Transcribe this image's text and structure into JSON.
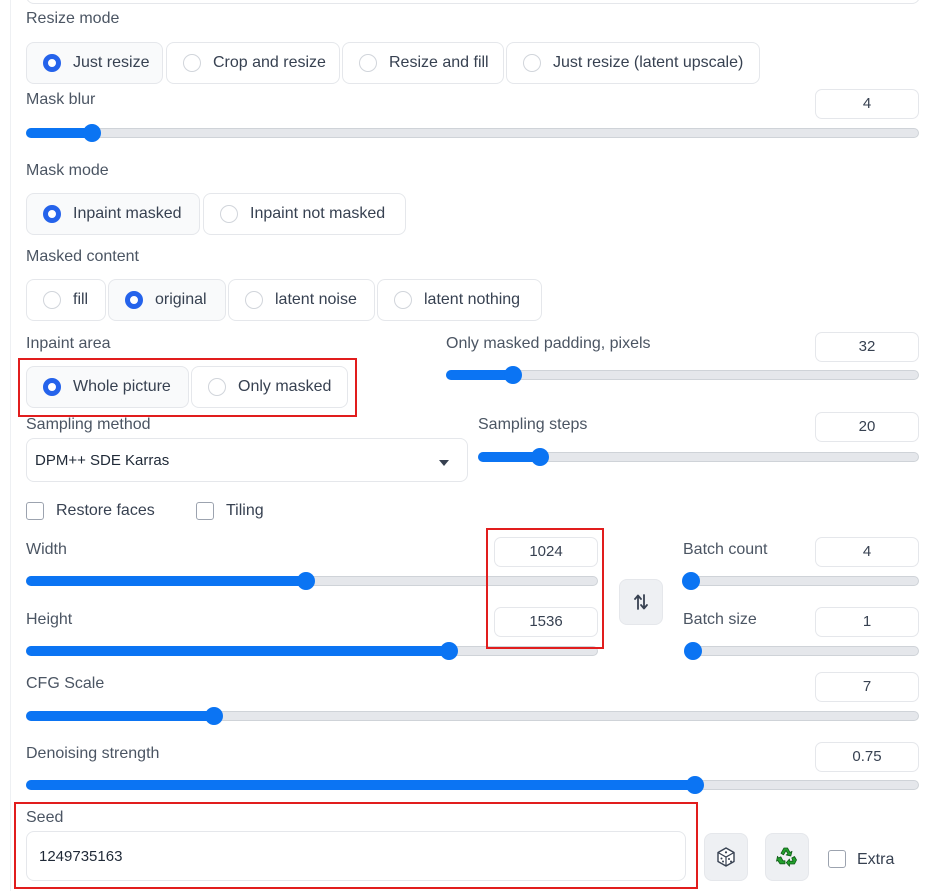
{
  "resize_mode": {
    "label": "Resize mode",
    "options": [
      "Just resize",
      "Crop and resize",
      "Resize and fill",
      "Just resize (latent upscale)"
    ],
    "selected": "Just resize"
  },
  "mask_blur": {
    "label": "Mask blur",
    "value": "4",
    "fraction": 0.073
  },
  "mask_mode": {
    "label": "Mask mode",
    "options": [
      "Inpaint masked",
      "Inpaint not masked"
    ],
    "selected": "Inpaint masked"
  },
  "masked_content": {
    "label": "Masked content",
    "options": [
      "fill",
      "original",
      "latent noise",
      "latent nothing"
    ],
    "selected": "original"
  },
  "inpaint_area": {
    "label": "Inpaint area",
    "options": [
      "Whole picture",
      "Only masked"
    ],
    "selected": "Whole picture"
  },
  "only_masked_padding": {
    "label": "Only masked padding, pixels",
    "value": "32",
    "fraction": 0.14
  },
  "sampling_method": {
    "label": "Sampling method",
    "value": "DPM++ SDE Karras"
  },
  "sampling_steps": {
    "label": "Sampling steps",
    "value": "20",
    "fraction": 0.14
  },
  "checkboxes": {
    "restore_faces": "Restore faces",
    "tiling": "Tiling"
  },
  "width": {
    "label": "Width",
    "value": "1024",
    "fraction": 0.49
  },
  "height": {
    "label": "Height",
    "value": "1536",
    "fraction": 0.74
  },
  "batch_count": {
    "label": "Batch count",
    "value": "4",
    "fraction": 0.03
  },
  "batch_size": {
    "label": "Batch size",
    "value": "1",
    "fraction": 0.0
  },
  "cfg_scale": {
    "label": "CFG Scale",
    "value": "7",
    "fraction": 0.21
  },
  "denoising_strength": {
    "label": "Denoising strength",
    "value": "0.75",
    "fraction": 0.75
  },
  "seed": {
    "label": "Seed",
    "value": "1249735163",
    "extra_label": "Extra"
  },
  "icons": {
    "swap": "swap-dimensions-icon",
    "random": "dice-icon",
    "reuse": "recycle-icon"
  },
  "colors": {
    "accent": "#0b74f3",
    "radio": "#2563eb",
    "highlight": "#e11d1d"
  }
}
